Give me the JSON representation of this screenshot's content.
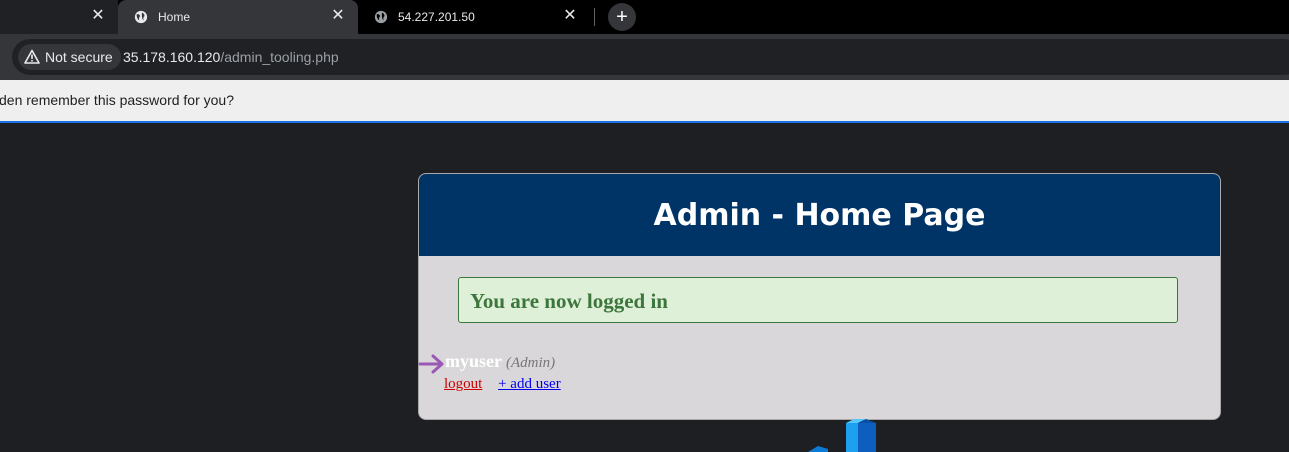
{
  "tabs": [
    {
      "title": ""
    },
    {
      "title": "Home"
    },
    {
      "title": "54.227.201.50"
    }
  ],
  "close_glyph": "✕",
  "newtab_glyph": "+",
  "address": {
    "security_label": "Not secure",
    "host": "35.178.160.120",
    "path": "/admin_tooling.php"
  },
  "password_bar": {
    "text": "den remember this password for you?"
  },
  "page": {
    "header": "Admin - Home Page",
    "notice": "You are now logged in",
    "username": "myuser",
    "role": "(Admin)",
    "logout_label": "logout",
    "add_user_label": "+ add user"
  },
  "colors": {
    "header_bg": "#003366",
    "notice_bg": "#dff0d8",
    "notice_text": "#3c763d",
    "arrow": "#9b59b6",
    "logo": "#1e90ff"
  },
  "icons": {
    "tab_favicon": "globe-icon",
    "security": "warning-triangle-icon",
    "pointer": "arrow-right-icon"
  }
}
